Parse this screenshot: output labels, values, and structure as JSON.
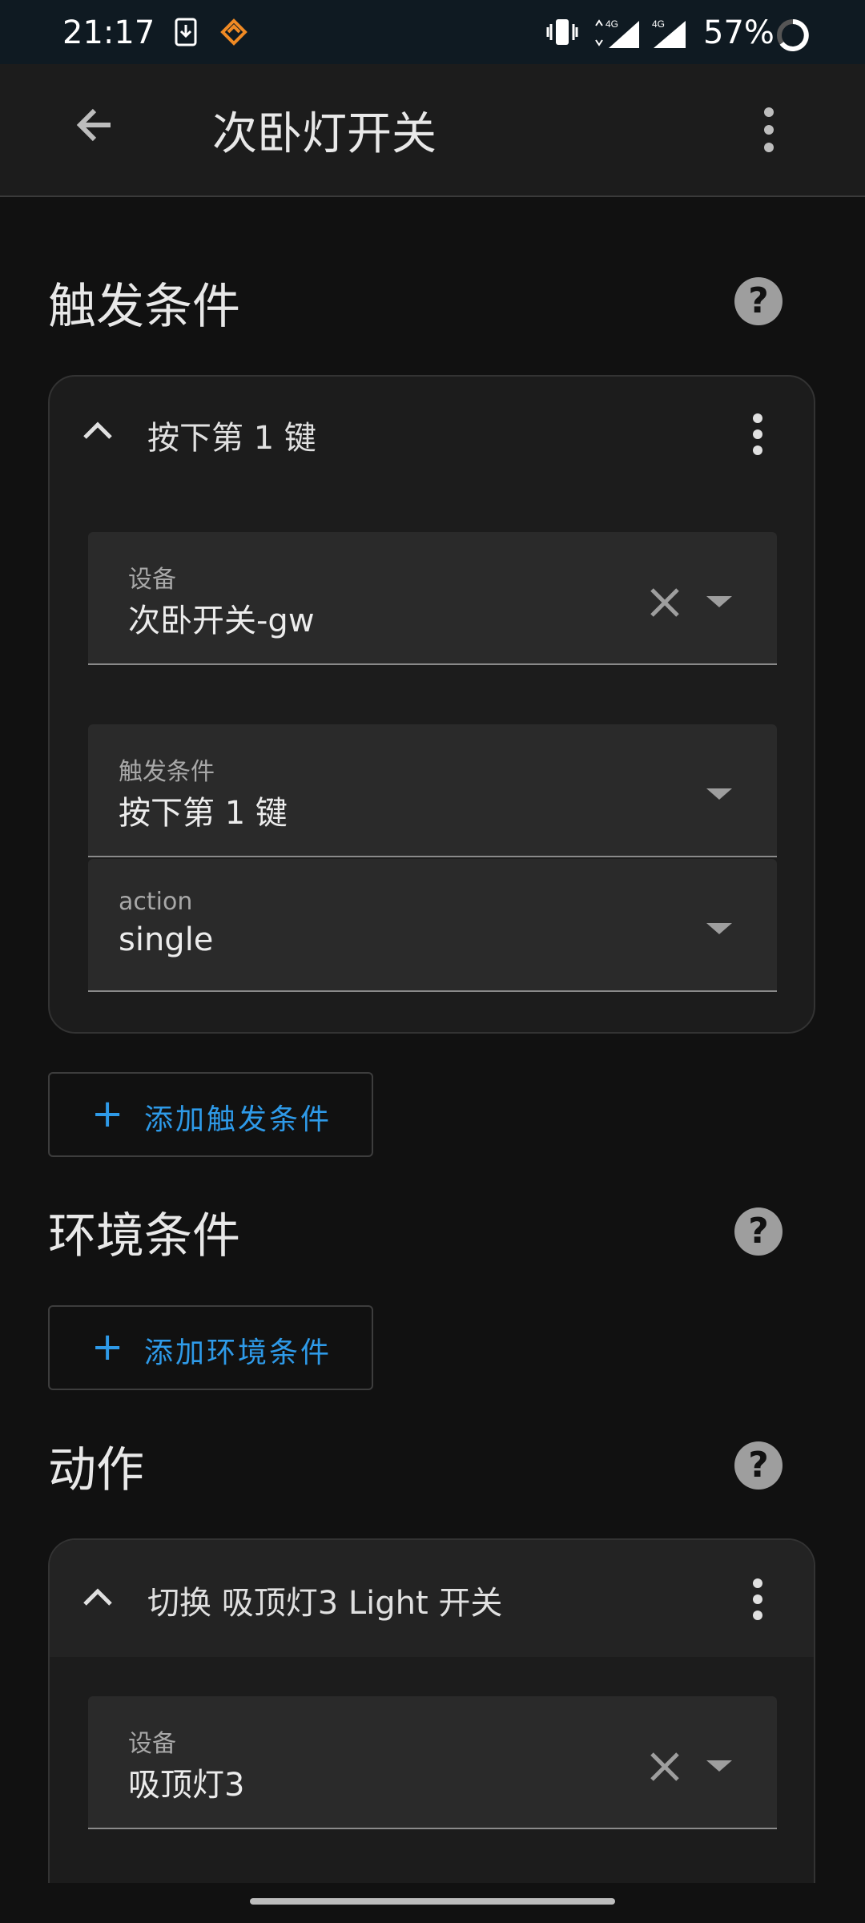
{
  "status_bar": {
    "time": "21:17",
    "battery": "57%",
    "network": "4G"
  },
  "app_bar": {
    "title": "次卧灯开关"
  },
  "triggers": {
    "title": "触发条件",
    "card": {
      "header": "按下第 1 键",
      "device_field": {
        "label": "设备",
        "value": "次卧开关-gw"
      },
      "trigger_field": {
        "label": "触发条件",
        "value": "按下第 1 键"
      },
      "action_field": {
        "label": "action",
        "value": "single"
      }
    },
    "add_label": "添加触发条件"
  },
  "conditions": {
    "title": "环境条件",
    "add_label": "添加环境条件"
  },
  "actions": {
    "title": "动作",
    "card": {
      "header": "切换 吸顶灯3 Light 开关",
      "device_field": {
        "label": "设备",
        "value": "吸顶灯3"
      }
    }
  },
  "icons": {
    "help": "?",
    "plus": "+"
  },
  "colors": {
    "accent": "#2e9ae8",
    "background": "#111111",
    "card": "#1c1c1c"
  }
}
